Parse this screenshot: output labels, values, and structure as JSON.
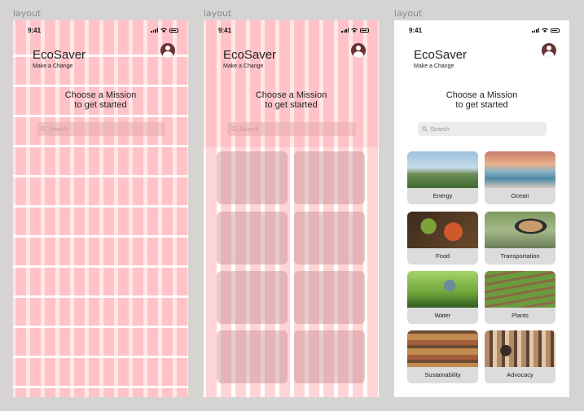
{
  "frames": [
    {
      "label": "layout"
    },
    {
      "label": "layout"
    },
    {
      "label": "layout"
    }
  ],
  "status": {
    "time": "9:41"
  },
  "app": {
    "title": "EcoSaver",
    "subtitle": "Make a Change"
  },
  "heading": {
    "line1": "Choose a Mission",
    "line2": "to get started"
  },
  "search": {
    "placeholder": "Search"
  },
  "missions": [
    {
      "label": "Energy",
      "icon": "wind-turbine-photo"
    },
    {
      "label": "Ocean",
      "icon": "ocean-photo"
    },
    {
      "label": "Food",
      "icon": "food-photo"
    },
    {
      "label": "Transportation",
      "icon": "car-mirror-photo"
    },
    {
      "label": "Water",
      "icon": "faucet-photo"
    },
    {
      "label": "Plants",
      "icon": "garden-photo"
    },
    {
      "label": "Sustainability",
      "icon": "jars-shelf-photo"
    },
    {
      "label": "Advocacy",
      "icon": "crowd-photo"
    }
  ],
  "colors": {
    "grid_overlay": "#ff7882",
    "avatar": "#6b3134",
    "search_bg": "#ebebeb",
    "card_label_bg": "#dcdcdc",
    "canvas": "#d6d4d3"
  }
}
